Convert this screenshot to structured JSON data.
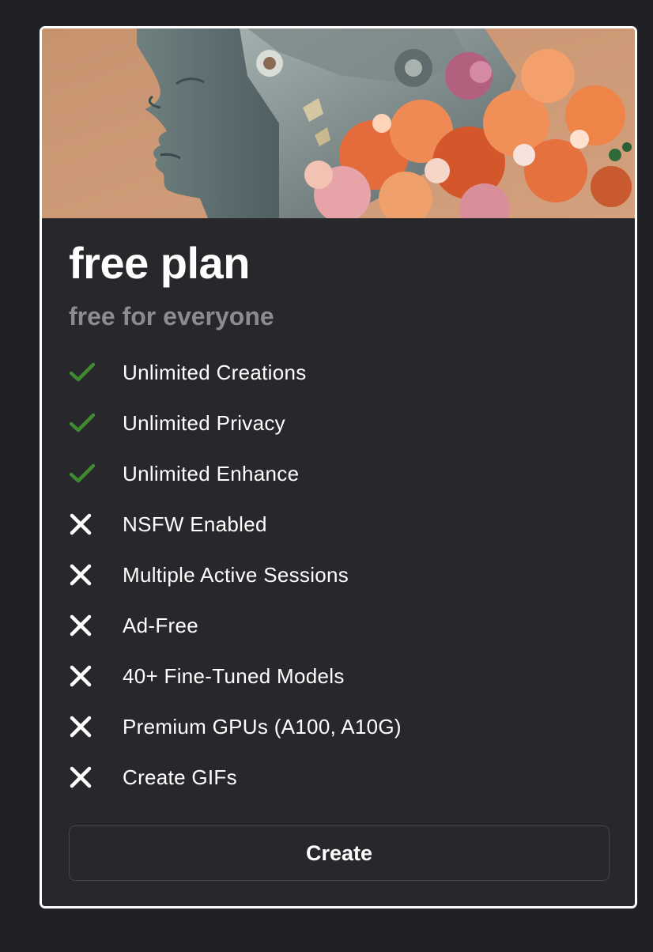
{
  "plan": {
    "title": "free plan",
    "subtitle": "free for everyone",
    "features": [
      {
        "label": "Unlimited Creations",
        "included": true,
        "icon": "check-icon"
      },
      {
        "label": "Unlimited Privacy",
        "included": true,
        "icon": "check-icon"
      },
      {
        "label": "Unlimited Enhance",
        "included": true,
        "icon": "check-icon"
      },
      {
        "label": "NSFW Enabled",
        "included": false,
        "icon": "cross-icon"
      },
      {
        "label": "Multiple Active Sessions",
        "included": false,
        "icon": "cross-icon"
      },
      {
        "label": "Ad-Free",
        "included": false,
        "icon": "cross-icon"
      },
      {
        "label": "40+ Fine-Tuned Models",
        "included": false,
        "icon": "cross-icon"
      },
      {
        "label": "Premium GPUs (A100, A10G)",
        "included": false,
        "icon": "cross-icon"
      },
      {
        "label": "Create GIFs",
        "included": false,
        "icon": "cross-icon"
      }
    ],
    "cta_label": "Create"
  },
  "colors": {
    "page_background": "#202124",
    "card_background": "#28282c",
    "card_border": "#ffffff",
    "title": "#ffffff",
    "subtitle": "#8a8c92",
    "check": "#3f8a2e",
    "cross": "#ffffff",
    "button_border": "#44454a"
  }
}
